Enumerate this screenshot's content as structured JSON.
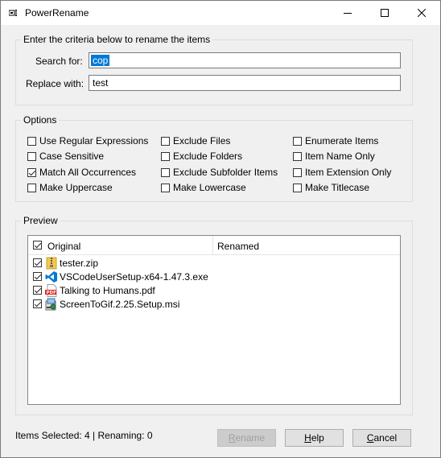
{
  "window": {
    "title": "PowerRename"
  },
  "criteria": {
    "legend": "Enter the criteria below to rename the items",
    "search_label": "Search for:",
    "search_value": "cop",
    "replace_label": "Replace with:",
    "replace_value": "test"
  },
  "options": {
    "legend": "Options",
    "items": [
      {
        "label": "Use Regular Expressions",
        "checked": false
      },
      {
        "label": "Case Sensitive",
        "checked": false
      },
      {
        "label": "Match All Occurrences",
        "checked": true
      },
      {
        "label": "Make Uppercase",
        "checked": false
      },
      {
        "label": "Exclude Files",
        "checked": false
      },
      {
        "label": "Exclude Folders",
        "checked": false
      },
      {
        "label": "Exclude Subfolder Items",
        "checked": false
      },
      {
        "label": "Make Lowercase",
        "checked": false
      },
      {
        "label": "Enumerate Items",
        "checked": false
      },
      {
        "label": "Item Name Only",
        "checked": false
      },
      {
        "label": "Item Extension Only",
        "checked": false
      },
      {
        "label": "Make Titlecase",
        "checked": false
      }
    ]
  },
  "preview": {
    "legend": "Preview",
    "col_original": "Original",
    "col_renamed": "Renamed",
    "rows": [
      {
        "name": "tester.zip",
        "icon": "zip-folder-icon",
        "checked": true
      },
      {
        "name": "VSCodeUserSetup-x64-1.47.3.exe",
        "icon": "vscode-icon",
        "checked": true
      },
      {
        "name": "Talking to Humans.pdf",
        "icon": "pdf-icon",
        "checked": true
      },
      {
        "name": "ScreenToGif.2.25.Setup.msi",
        "icon": "msi-installer-icon",
        "checked": true
      }
    ]
  },
  "status": {
    "text": "Items Selected: 4 | Renaming: 0"
  },
  "buttons": {
    "rename_mnemonic": "R",
    "rename_rest": "ename",
    "help_mnemonic": "H",
    "help_rest": "elp",
    "cancel_mnemonic": "C",
    "cancel_rest": "ancel"
  }
}
